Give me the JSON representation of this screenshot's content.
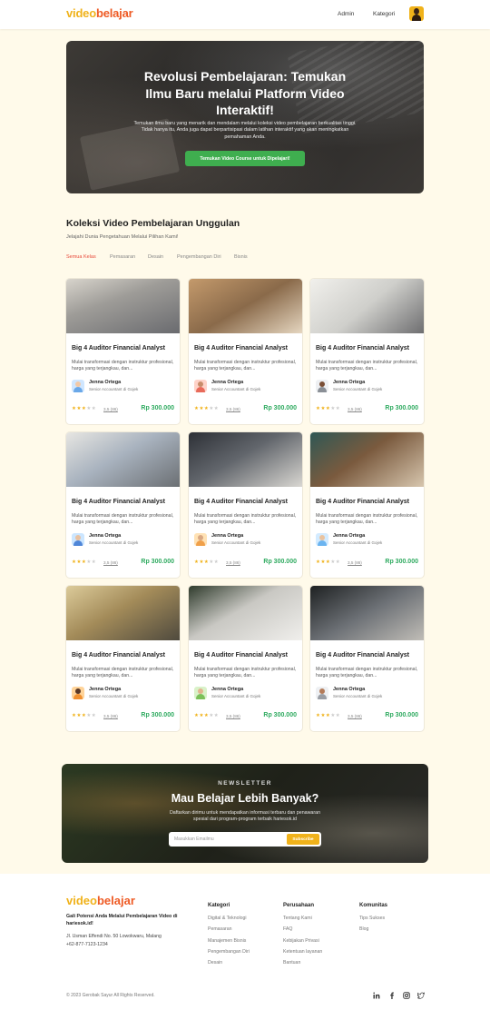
{
  "brand": {
    "logo_part1": "video",
    "logo_part2": "belajar"
  },
  "header": {
    "nav": [
      "Admin",
      "Kategori"
    ]
  },
  "hero": {
    "title": "Revolusi Pembelajaran: Temukan Ilmu Baru melalui Platform Video Interaktif!",
    "subtitle": "Temukan ilmu baru yang menarik dan mendalam melalui koleksi video pembelajaran berkualitas tinggi. Tidak hanya itu, Anda juga dapat berpartisipasi dalam latihan interaktif yang akan meningkatkan pemahaman Anda.",
    "cta": "Temukan Video Course untuk Dipelajari!"
  },
  "collection": {
    "title": "Koleksi Video Pembelajaran Unggulan",
    "subtitle": "Jelajahi Dunia Pengetahuan Melalui Pilihan Kami!",
    "tabs": [
      "Semua Kelas",
      "Pemasaran",
      "Desain",
      "Pengembangan Diri",
      "Bisnis"
    ]
  },
  "cards": [
    {
      "title": "Big 4 Auditor Financial Analyst",
      "desc": "Mulai transformasi dengan instruktur profesional, harga yang terjangkau, dan...",
      "author": "Jenna Ortega",
      "role": "Senior Accountant di Gojek",
      "rating": "3,5 (86)",
      "price": "Rp 300.000"
    },
    {
      "title": "Big 4 Auditor Financial Analyst",
      "desc": "Mulai transformasi dengan instruktur profesional, harga yang terjangkau, dan...",
      "author": "Jenna Ortega",
      "role": "Senior Accountant di Gojek",
      "rating": "3,5 (86)",
      "price": "Rp 300.000"
    },
    {
      "title": "Big 4 Auditor Financial Analyst",
      "desc": "Mulai transformasi dengan instruktur profesional, harga yang terjangkau, dan...",
      "author": "Jenna Ortega",
      "role": "Senior Accountant di Gojek",
      "rating": "3,5 (86)",
      "price": "Rp 300.000"
    },
    {
      "title": "Big 4 Auditor Financial Analyst",
      "desc": "Mulai transformasi dengan instruktur profesional, harga yang terjangkau, dan...",
      "author": "Jenna Ortega",
      "role": "Senior Accountant di Gojek",
      "rating": "3,5 (86)",
      "price": "Rp 300.000"
    },
    {
      "title": "Big 4 Auditor Financial Analyst",
      "desc": "Mulai transformasi dengan instruktur profesional, harga yang terjangkau, dan...",
      "author": "Jenna Ortega",
      "role": "Senior Accountant di Gojek",
      "rating": "3,5 (86)",
      "price": "Rp 300.000"
    },
    {
      "title": "Big 4 Auditor Financial Analyst",
      "desc": "Mulai transformasi dengan instruktur profesional, harga yang terjangkau, dan...",
      "author": "Jenna Ortega",
      "role": "Senior Accountant di Gojek",
      "rating": "3,5 (86)",
      "price": "Rp 300.000"
    },
    {
      "title": "Big 4 Auditor Financial Analyst",
      "desc": "Mulai transformasi dengan instruktur profesional, harga yang terjangkau, dan...",
      "author": "Jenna Ortega",
      "role": "Senior Accountant di Gojek",
      "rating": "3,5 (86)",
      "price": "Rp 300.000"
    },
    {
      "title": "Big 4 Auditor Financial Analyst",
      "desc": "Mulai transformasi dengan instruktur profesional, harga yang terjangkau, dan...",
      "author": "Jenna Ortega",
      "role": "Senior Accountant di Gojek",
      "rating": "3,5 (86)",
      "price": "Rp 300.000"
    },
    {
      "title": "Big 4 Auditor Financial Analyst",
      "desc": "Mulai transformasi dengan instruktur profesional, harga yang terjangkau, dan...",
      "author": "Jenna Ortega",
      "role": "Senior Accountant di Gojek",
      "rating": "3,5 (86)",
      "price": "Rp 300.000"
    }
  ],
  "card_stars": {
    "filled": 2,
    "half": 1,
    "total": 5
  },
  "newsletter": {
    "label": "NEWSLETTER",
    "title": "Mau Belajar Lebih Banyak?",
    "subtitle": "Daftarkan dirimu untuk mendapatkan informasi terbaru dan penawaran spesial dari program-program terbaik hariesok.id",
    "placeholder": "Masukkan Emailmu",
    "button": "Subscribe"
  },
  "footer": {
    "tagline": "Gali Potensi Anda Melalui Pembelajaran Video di hariesok.id!",
    "address": "Jl. Usman Effendi No. 50 Lowokwaru, Malang",
    "phone": "+62-877-7123-1234",
    "columns": [
      {
        "title": "Kategori",
        "links": [
          "Digital & Teknologi",
          "Pemasaran",
          "Manajemen Bisnis",
          "Pengembangan Diri",
          "Desain"
        ]
      },
      {
        "title": "Perusahaan",
        "links": [
          "Tentang Kami",
          "FAQ",
          "Kebijakan Privasi",
          "Ketentuan layanan",
          "Bantuan"
        ]
      },
      {
        "title": "Komunitas",
        "links": [
          "Tips Sukses",
          "Blog"
        ]
      }
    ],
    "copyright": "© 2023 Gerobak Sayur All Rights Reserved.",
    "social_icons": [
      "linkedin-icon",
      "facebook-icon",
      "instagram-icon",
      "twitter-icon"
    ]
  },
  "colors": {
    "accent": "#f0b21a",
    "logo_secondary": "#ee5a24",
    "price": "#2eaa5f",
    "active_tab": "#e84b3c",
    "cta": "#3fae4f",
    "background": "#fffaea"
  }
}
